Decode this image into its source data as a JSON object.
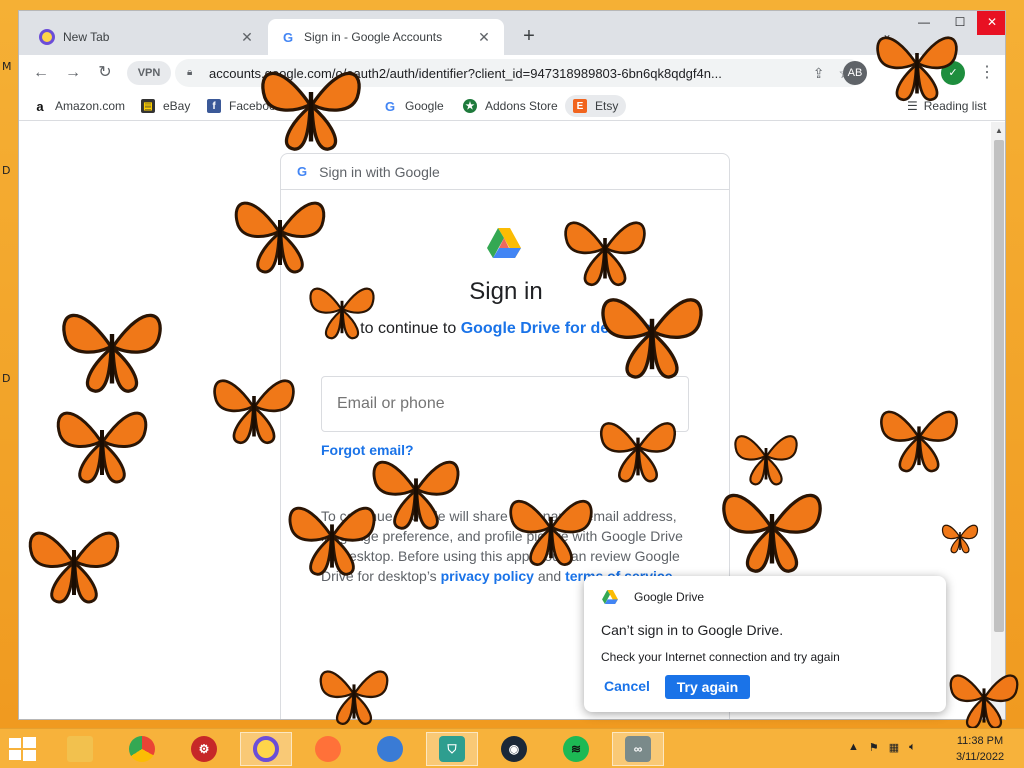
{
  "desktop": {
    "letters": [
      "M",
      "D",
      "D"
    ]
  },
  "browser": {
    "tabs": [
      {
        "title": "New Tab",
        "icon": "browser-logo-icon",
        "active": false
      },
      {
        "title": "Sign in - Google Accounts",
        "icon": "google-g-icon",
        "active": true
      }
    ],
    "toolbar": {
      "vpn_label": "VPN",
      "url": "accounts.google.com/o/oauth2/auth/identifier?client_id=947318989803-6bn6qk8qdgf4n..."
    },
    "bookmarks": [
      {
        "label": "Amazon.com",
        "icon": "amazon-icon"
      },
      {
        "label": "eBay",
        "icon": "ebay-icon"
      },
      {
        "label": "Facebook",
        "icon": "facebook-icon"
      },
      {
        "label": "Google",
        "icon": "google-icon"
      },
      {
        "label": "Addons Store",
        "icon": "addons-icon"
      },
      {
        "label": "Etsy",
        "icon": "etsy-icon"
      }
    ],
    "reading_list": "Reading list"
  },
  "signin": {
    "header": "Sign in with Google",
    "title": "Sign in",
    "subtitle_prefix": "to continue to ",
    "app_name": "Google Drive for desktop",
    "email_placeholder": "Email or phone",
    "forgot_email": "Forgot email?",
    "terms_text": "To continue, Google will share your name, email address, language preference, and profile picture with Google Drive for desktop. Before using this app, you can review Google Drive for desktop’s ",
    "privacy_policy": "privacy policy",
    "and": " and ",
    "terms_of_service": "terms of service"
  },
  "notification": {
    "app": "Google Drive",
    "title": "Can’t sign in to Google Drive.",
    "body": "Check your Internet connection and try again",
    "cancel": "Cancel",
    "retry": "Try again"
  },
  "taskbar": {
    "apps": [
      "file-explorer",
      "chrome",
      "security-app",
      "browser",
      "firefox",
      "thunderbird",
      "vpn-app",
      "steam",
      "spotify",
      "remote-app"
    ],
    "time": "11:38 PM",
    "date": "3/11/2022"
  },
  "colors": {
    "accent": "#1a73e8",
    "desktop": "#f0a030",
    "taskbar": "#f7b23b"
  }
}
